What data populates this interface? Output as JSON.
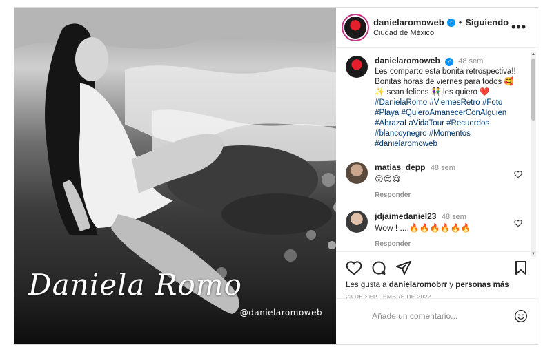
{
  "photo": {
    "title": "Daniela Romo",
    "handle": "@danielaromoweb"
  },
  "header": {
    "username": "danielaromoweb",
    "separator": "•",
    "follow_label": "Siguiendo",
    "location": "Ciudad de México",
    "more_label": "•••"
  },
  "caption": {
    "username": "danielaromoweb",
    "ago": "48 sem",
    "text": "Les comparto esta bonita retrospectiva!! Bonitas horas de viernes para todos 🥰✨ sean felices 👫 les quiero ❤️",
    "hashtags": [
      "#DanielaRomo",
      "#ViernesRetro",
      "#Foto",
      "#Playa",
      "#QuieroAmanecerConAlguien",
      "#AbrazaLaVidaTour",
      "#Recuerdos",
      "#blancoynegro",
      "#Momentos",
      "#danielaromoweb"
    ]
  },
  "comments": [
    {
      "username": "matias_depp",
      "ago": "48 sem",
      "text": "😮😍😋",
      "reply_label": "Responder"
    },
    {
      "username": "jdjaimedaniel23",
      "ago": "48 sem",
      "text": "Wow ! ....🔥🔥🔥🔥🔥🔥",
      "reply_label": "Responder"
    }
  ],
  "likes": {
    "prefix": "Les gusta a",
    "user": "danielaromobrr",
    "connector": "y",
    "suffix": "personas más"
  },
  "date": "23 DE SEPTIEMBRE DE 2022",
  "add_comment": {
    "placeholder": "Añade un comentario..."
  },
  "icons": [
    "heart-icon",
    "comment-icon",
    "share-icon",
    "bookmark-icon",
    "smile-icon"
  ]
}
